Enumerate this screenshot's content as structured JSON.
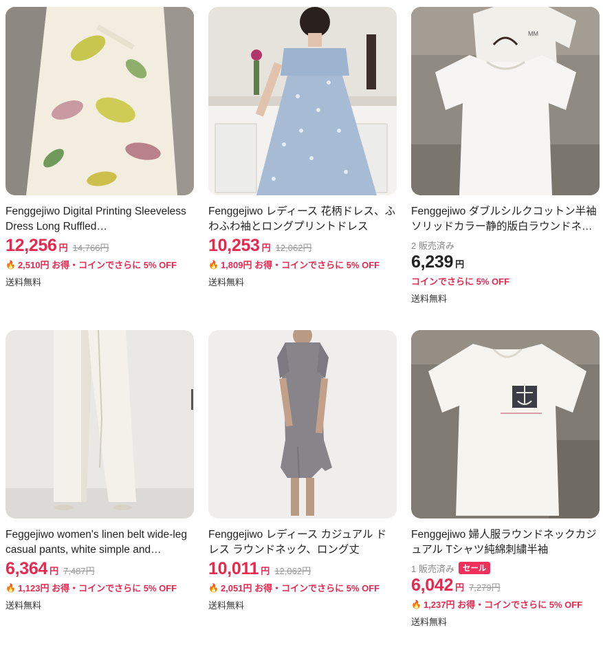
{
  "products": [
    {
      "title": "Fenggejiwo Digital Printing Sleeveless Dress Long Ruffled…",
      "price": "12,256",
      "price_unit": "円",
      "original_price": "14,766円",
      "promo_text": "2,510円 お得・コインでさらに 5% OFF",
      "shipping": "送料無料"
    },
    {
      "title": "Fenggejiwo レディース 花柄ドレス、ふわふわ袖とロングプリントドレス",
      "price": "10,253",
      "price_unit": "円",
      "original_price": "12,062円",
      "promo_text": "1,809円 お得・コインでさらに 5% OFF",
      "shipping": "送料無料"
    },
    {
      "title": "Fenggejiwo ダブルシルクコットン半袖ソリッドカラー静的版白ラウンドネック T シャツ",
      "sold": "2 販売済み",
      "price": "6,239",
      "price_unit": "円",
      "promo_text": "コインでさらに 5% OFF",
      "shipping": "送料無料"
    },
    {
      "title": "Feggejiwo women's linen belt wide-leg casual pants, white simple and…",
      "price": "6,364",
      "price_unit": "円",
      "original_price": "7,487円",
      "promo_text": "1,123円 お得・コインでさらに 5% OFF",
      "shipping": "送料無料"
    },
    {
      "title": "Fenggejiwo レディース カジュアル ドレス ラウンドネック、ロング丈",
      "price": "10,011",
      "price_unit": "円",
      "original_price": "12,062円",
      "promo_text": "2,051円 お得・コインでさらに 5% OFF",
      "shipping": "送料無料"
    },
    {
      "title": "Fenggejiwo 婦人服ラウンドネックカジュアル Tシャツ純綿刺繍半袖",
      "sold": "1 販売済み",
      "sale_badge": "セール",
      "price": "6,042",
      "price_unit": "円",
      "original_price": "7,279円",
      "promo_text": "1,237円 お得・コインでさらに 5% OFF",
      "shipping": "送料無料"
    }
  ],
  "icons": {
    "promo": "flame-icon"
  },
  "colors": {
    "accent": "#e8284f",
    "muted": "#999999"
  }
}
